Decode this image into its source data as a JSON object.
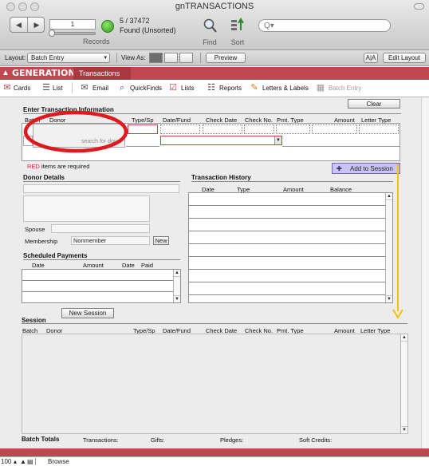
{
  "window": {
    "title": "gnTRANSACTIONS"
  },
  "toolbar": {
    "record_number": "1",
    "records_label": "Records",
    "count": "5 / 37472",
    "found": "Found (Unsorted)",
    "find_label": "Find",
    "sort_label": "Sort",
    "search_placeholder": "Q▾"
  },
  "layoutbar": {
    "layout_label": "Layout:",
    "layout_value": "Batch Entry",
    "view_as_label": "View As:",
    "preview_label": "Preview",
    "font_size_label": "A|A",
    "edit_layout_label": "Edit Layout"
  },
  "brand": {
    "name": "GENERATIONS",
    "tab": "Transactions"
  },
  "modules": [
    {
      "label": "Cards",
      "icon": "✉"
    },
    {
      "label": "List",
      "icon": "☰"
    },
    {
      "label": "Email",
      "icon": "✉"
    },
    {
      "label": "QuickFinds",
      "icon": "⌕"
    },
    {
      "label": "Lists",
      "icon": "☑"
    },
    {
      "label": "Reports",
      "icon": "☷"
    },
    {
      "label": "Letters & Labels",
      "icon": "✎"
    },
    {
      "label": "Batch Entry",
      "icon": "▦"
    }
  ],
  "entry": {
    "title": "Enter Transaction Information",
    "clear_label": "Clear",
    "headers": [
      "Batch",
      "Donor",
      "Type/Sp",
      "Date/Fund",
      "Check Date",
      "Check No.",
      "Pmt. Type",
      "Amount",
      "Letter Type"
    ],
    "donor_placeholder": "search for donor",
    "required_note_red": "RED",
    "required_note_rest": "items are required",
    "add_to_session_label": "Add to Session"
  },
  "donor_details": {
    "title": "Donor Details",
    "spouse_label": "Spouse",
    "membership_label": "Membership",
    "membership_value": "Nonmember",
    "new_label": "New"
  },
  "scheduled": {
    "title": "Scheduled Payments",
    "headers": [
      "Date",
      "Amount",
      "Date",
      "Paid"
    ]
  },
  "history": {
    "title": "Transaction History",
    "headers": [
      "Date",
      "Type",
      "Amount",
      "Balance"
    ]
  },
  "session": {
    "new_session_label": "New Session",
    "title": "Session",
    "headers": [
      "Batch",
      "Donor",
      "Type/Sp",
      "Date/Fund",
      "Check Date",
      "Check No.",
      "Pmt. Type",
      "Amount",
      "Letter Type"
    ]
  },
  "totals": {
    "title": "Batch Totals",
    "transactions_label": "Transactions:",
    "gifts_label": "Gifts:",
    "pledges_label": "Pledges:",
    "soft_credits_label": "Soft Credits:"
  },
  "statusbar": {
    "zoom": "100",
    "mode": "Browse"
  },
  "colors": {
    "brand_red": "#c1474f",
    "required_red": "#d6373f",
    "add_button_purple": "#c9c4f5"
  }
}
